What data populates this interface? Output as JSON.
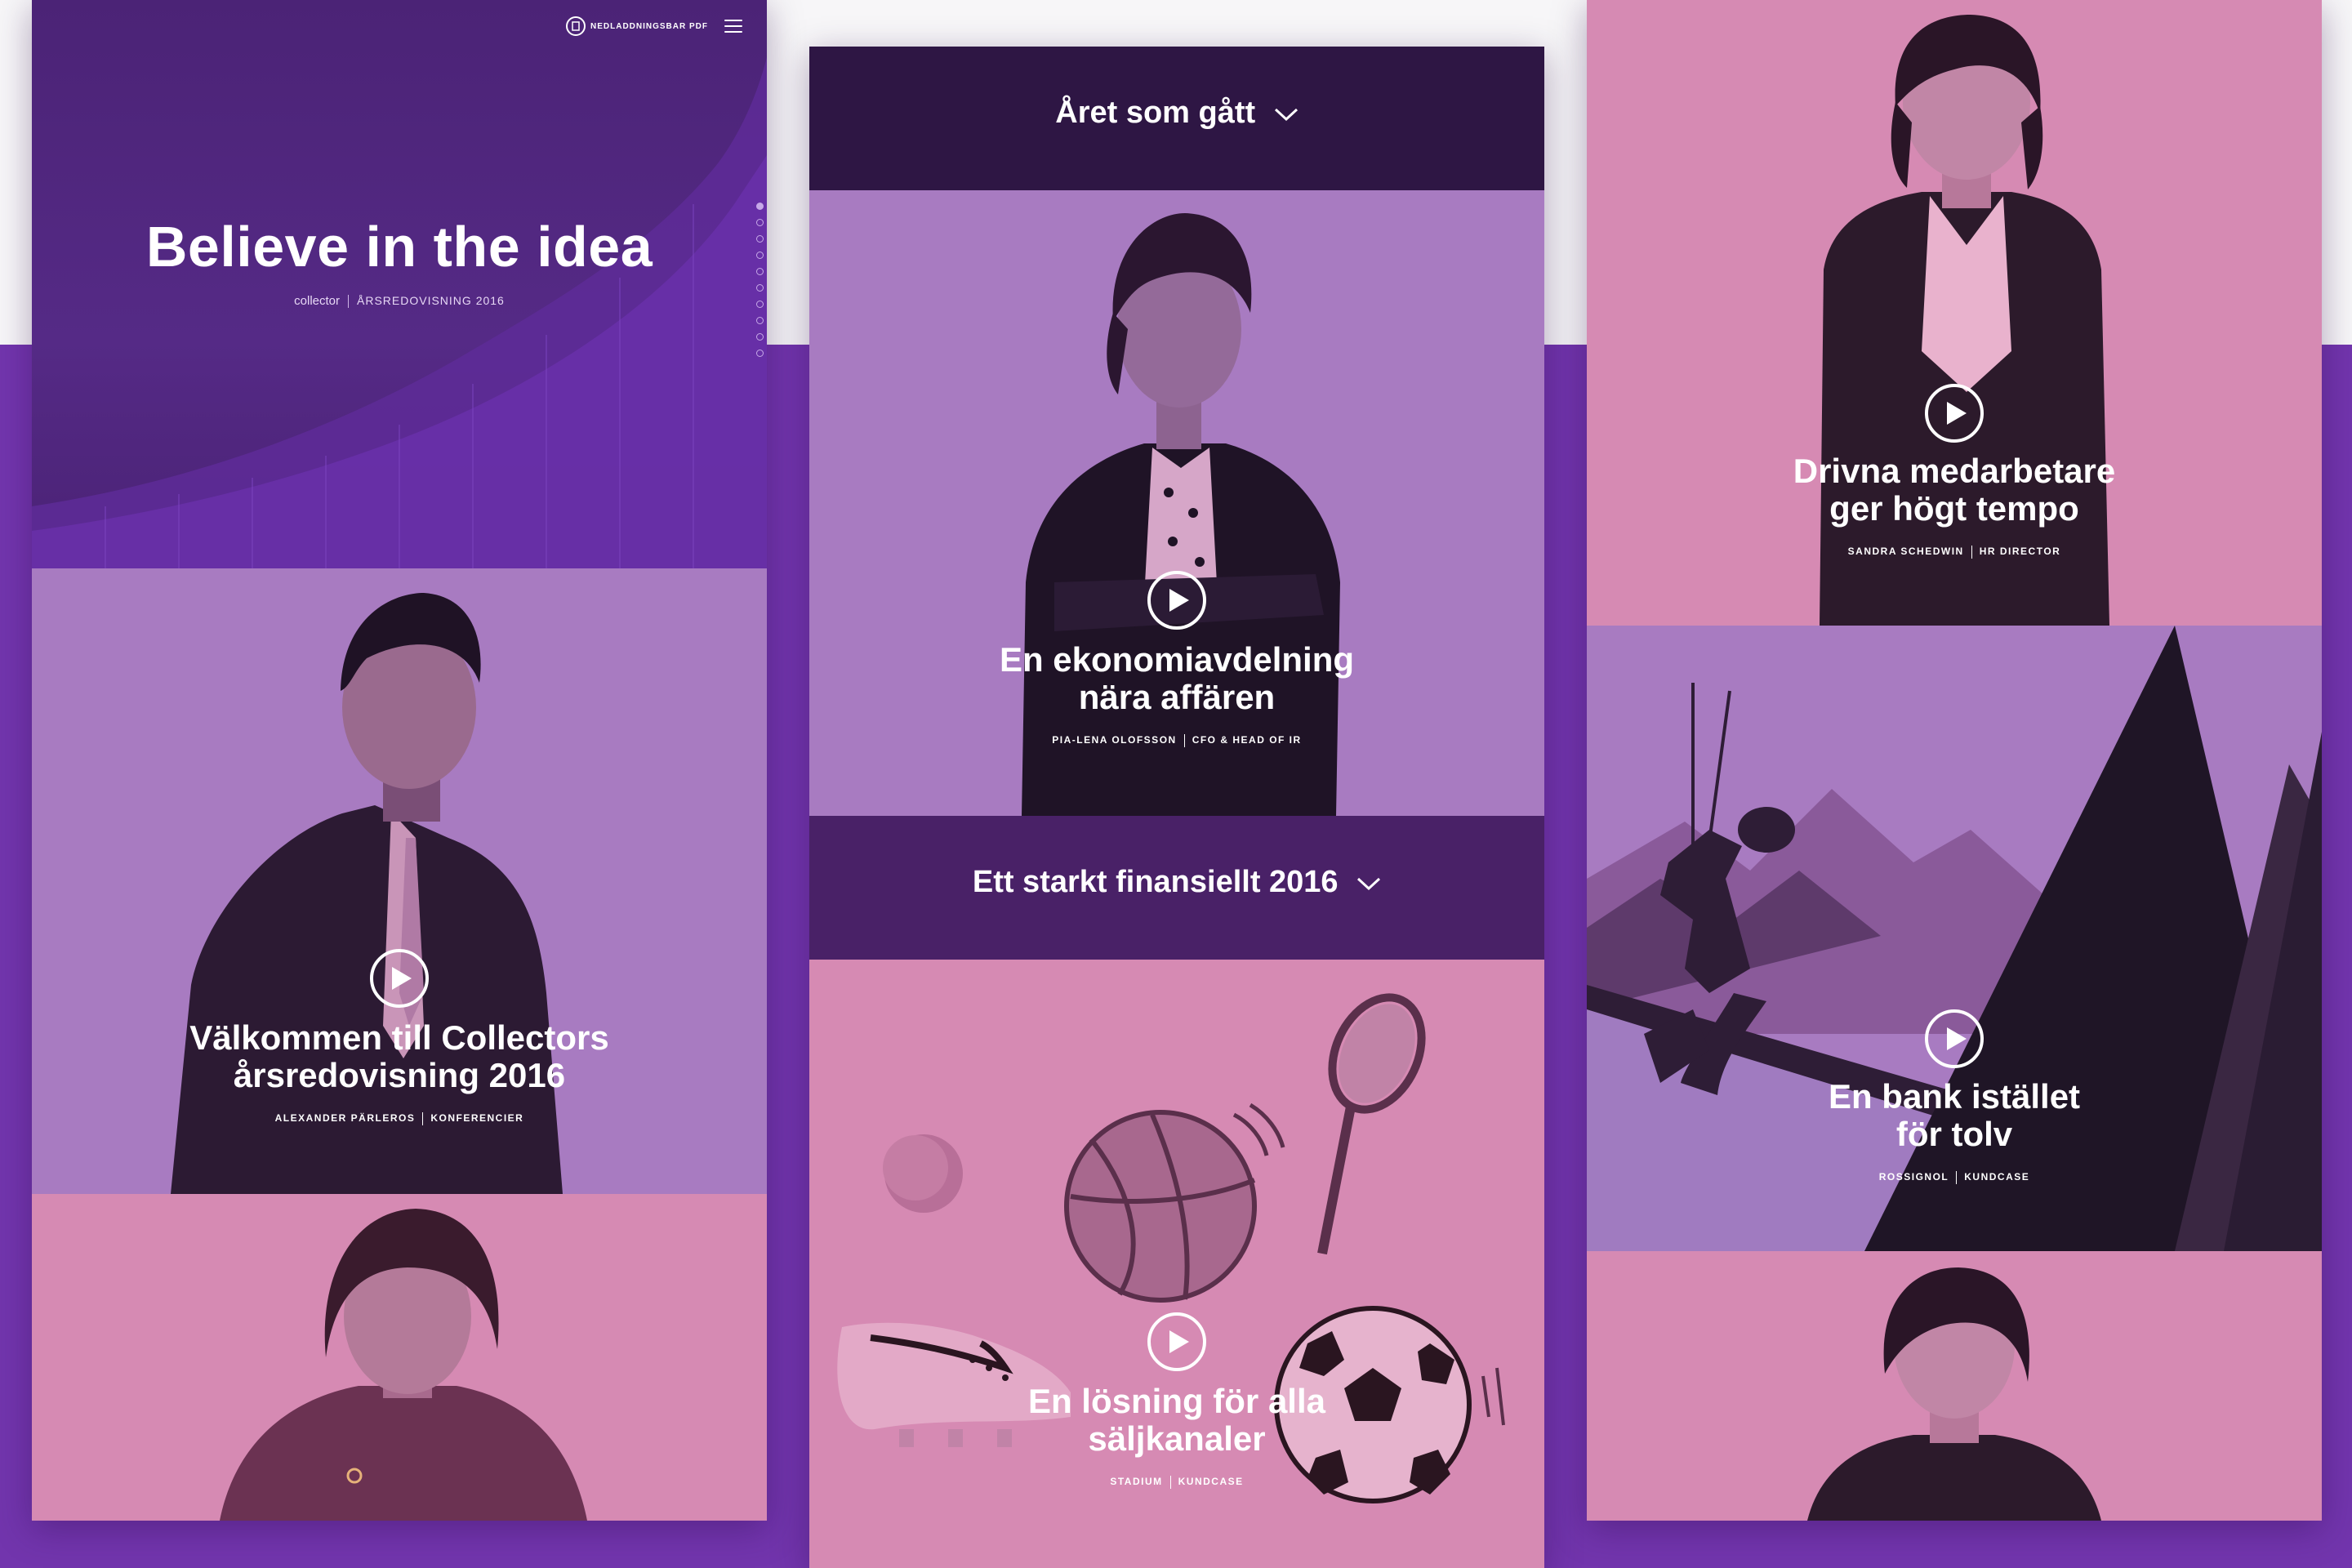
{
  "colors": {
    "background_band": "#7235ad",
    "hero_purple": "#4b2376",
    "lilac": "#a87bc1",
    "pink": "#d68ab3",
    "dark_header": "#2e1644",
    "dark_header_2": "#492167"
  },
  "col1": {
    "topbar": {
      "pdf_label": "NEDLADDNINGSBAR PDF",
      "pdf_icon": "document-icon",
      "menu_icon": "hamburger-menu-icon"
    },
    "hero": {
      "title": "Believe in the idea",
      "brand": "collector",
      "subtitle": "ÅRSREDOVISNING 2016"
    },
    "card1": {
      "title_line1": "Välkommen till Collectors",
      "title_line2": "årsredovisning 2016",
      "person": "ALEXANDER PÄRLEROS",
      "role": "KONFERENCIER"
    }
  },
  "col2": {
    "section1": "Året som gått",
    "card1": {
      "title_line1": "En ekonomiavdelning",
      "title_line2": "nära affären",
      "person": "PIA-LENA OLOFSSON",
      "role": "CFO & HEAD OF IR"
    },
    "section2": "Ett starkt finansiellt 2016",
    "card2": {
      "title_line1": "En lösning för alla",
      "title_line2": "säljkanaler",
      "person": "STADIUM",
      "role": "KUNDCASE"
    }
  },
  "col3": {
    "card1": {
      "title_line1": "Drivna medarbetare",
      "title_line2": "ger högt tempo",
      "person": "SANDRA SCHEDWIN",
      "role": "HR DIRECTOR"
    },
    "card2": {
      "title_line1": "En bank istället",
      "title_line2": "för tolv",
      "person": "ROSSIGNOL",
      "role": "KUNDCASE"
    }
  }
}
